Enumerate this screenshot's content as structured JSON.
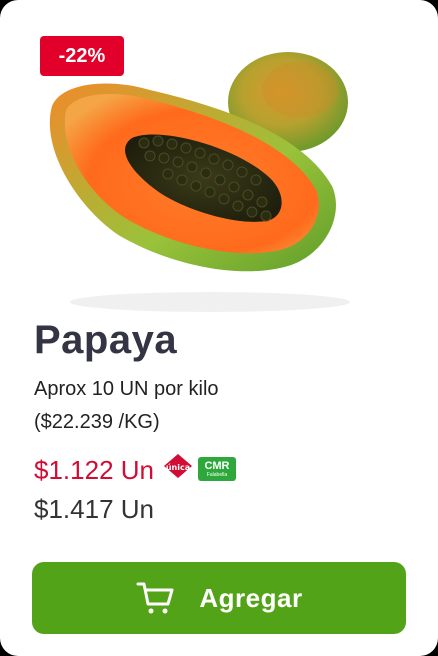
{
  "product": {
    "discount_badge": "-22%",
    "title": "Papaya",
    "description_line1": "Aprox 10 UN por kilo",
    "description_line2": "($22.239 /KG)",
    "promo_price": "$1.122 Un",
    "regular_price": "$1.417 Un",
    "image_icon": "papaya-image"
  },
  "logos": {
    "unica_text": "única",
    "cmr_text": "CMR",
    "cmr_subtext": "Falabella"
  },
  "actions": {
    "add_label": "Agregar",
    "add_icon": "cart-icon"
  },
  "colors": {
    "discount": "#e2002b",
    "promo_price": "#d10c35",
    "button": "#53a318",
    "cmr": "#2ea83a"
  }
}
